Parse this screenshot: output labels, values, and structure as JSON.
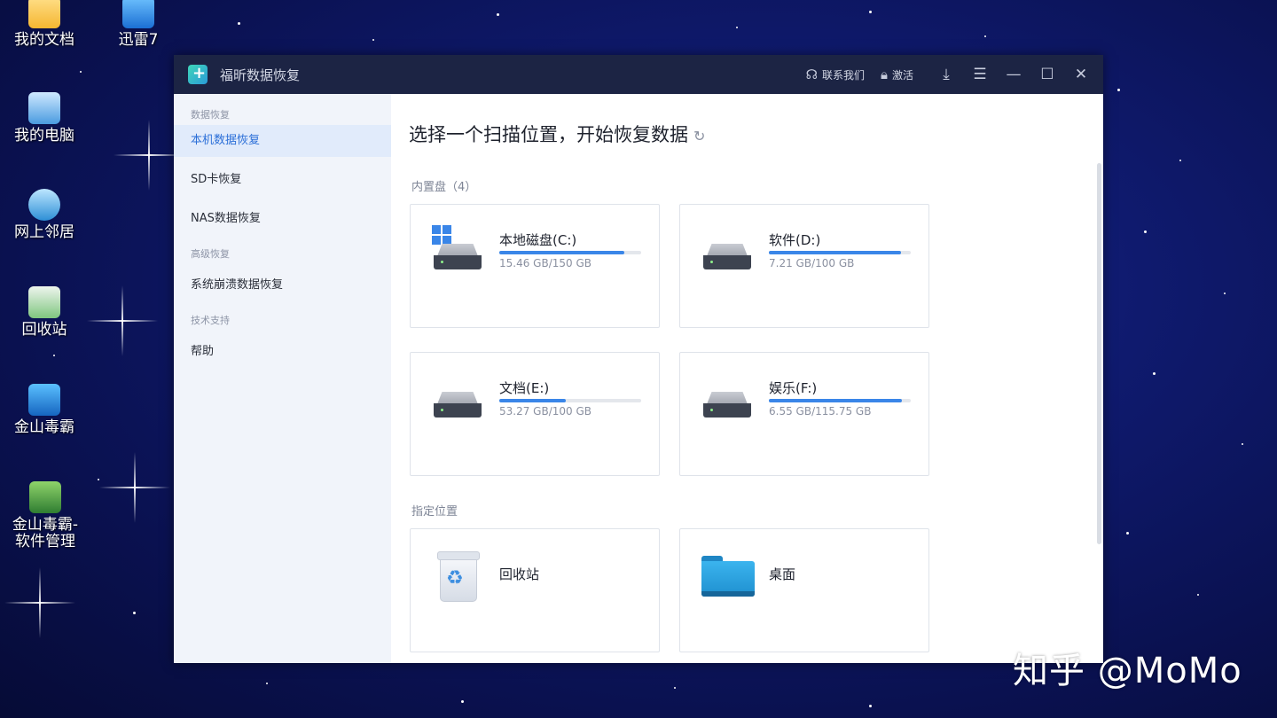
{
  "desktop": {
    "icons": [
      {
        "label": "我的文档"
      },
      {
        "label": "迅雷7"
      },
      {
        "label": "我的电脑"
      },
      {
        "label": "网上邻居"
      },
      {
        "label": "回收站"
      },
      {
        "label": "金山毒霸"
      },
      {
        "label": "金山毒霸-软件管理"
      }
    ],
    "watermark": "知乎 @MoMo"
  },
  "window": {
    "title": "福昕数据恢复",
    "contact_label": "联系我们",
    "activate_label": "激活",
    "buttons": [
      "download-icon",
      "menu-icon",
      "minimize-icon",
      "maximize-icon",
      "close-icon"
    ]
  },
  "sidebar": {
    "groups": [
      {
        "label": "数据恢复",
        "items": [
          {
            "label": "本机数据恢复",
            "active": true
          },
          {
            "label": "SD卡恢复"
          },
          {
            "label": "NAS数据恢复"
          }
        ]
      },
      {
        "label": "高级恢复",
        "items": [
          {
            "label": "系统崩溃数据恢复"
          }
        ]
      },
      {
        "label": "技术支持",
        "items": [
          {
            "label": "帮助"
          }
        ]
      }
    ]
  },
  "main": {
    "title": "选择一个扫描位置，开始恢复数据",
    "builtin_label": "内置盘（4）",
    "drives": [
      {
        "name": "本地磁盘(C:)",
        "size": "15.46 GB/150 GB",
        "used_fraction": 0.88,
        "system": true
      },
      {
        "name": "软件(D:)",
        "size": "7.21 GB/100 GB",
        "used_fraction": 0.93
      },
      {
        "name": "文档(E:)",
        "size": "53.27 GB/100 GB",
        "used_fraction": 0.47
      },
      {
        "name": "娱乐(F:)",
        "size": "6.55 GB/115.75 GB",
        "used_fraction": 0.94
      }
    ],
    "location_label": "指定位置",
    "locations": [
      {
        "name": "回收站"
      },
      {
        "name": "桌面"
      }
    ]
  },
  "colors": {
    "accent": "#3a86e8",
    "titlebar": "#1c2444",
    "sidebar_active": "#e1ebfb"
  }
}
